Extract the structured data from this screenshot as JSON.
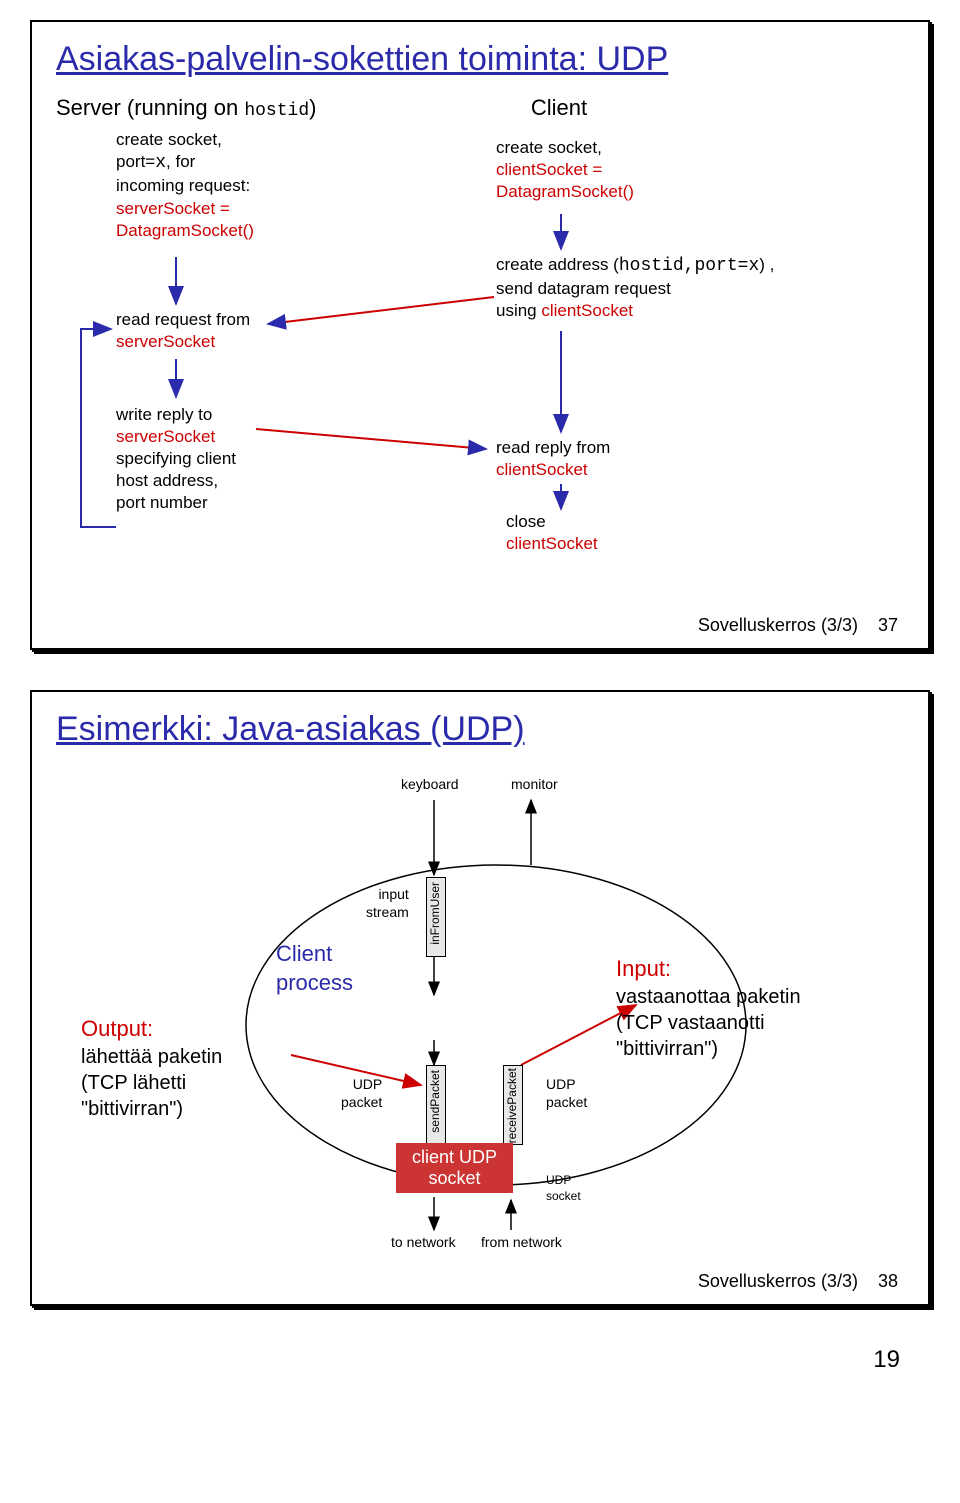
{
  "slide1": {
    "title": "Asiakas-palvelin-sokettien toiminta: UDP",
    "server_heading": "Server (running on ",
    "server_hostid": "hostid",
    "server_heading_close": ")",
    "client_heading": "Client",
    "s1_l1": "create socket,",
    "s1_l2a": "port=",
    "s1_l2b": "x",
    "s1_l2c": ", for",
    "s1_l3": "incoming request:",
    "s1_l4a": "serverSocket =",
    "s1_l4b": "DatagramSocket()",
    "s2_l1": "read request from",
    "s2_l2": "serverSocket",
    "s3_l1": "write reply to",
    "s3_l2": "serverSocket",
    "s3_l3": "specifying client",
    "s3_l4": "host address,",
    "s3_l5": "port number",
    "c1_l1": "create socket,",
    "c1_l2a": "clientSocket =",
    "c1_l2b": "DatagramSocket()",
    "c2_l1a": "create address (",
    "c2_l1b": "hostid,port=x",
    "c2_l1c": ") ,",
    "c2_l2": "send datagram request",
    "c2_l3a": "using ",
    "c2_l3b": "clientSocket",
    "c3_l1": "read reply from",
    "c3_l2": "clientSocket",
    "c4_l1": "close",
    "c4_l2": "clientSocket",
    "footer_label": "Sovelluskerros (3/3)",
    "footer_num": "37"
  },
  "slide2": {
    "title": "Esimerkki: Java-asiakas (UDP)",
    "keyboard": "keyboard",
    "monitor": "monitor",
    "input_stream": "input\nstream",
    "infromuser": "inFromUser",
    "client_process": "Client\nprocess",
    "output_h": "Output:",
    "output_b": "lähettää paketin\n(TCP lähetti\n\"bittivirran\")",
    "input_h": "Input:",
    "input_b": "vastaanottaa paketin\n(TCP vastaanotti\n\"bittivirran\")",
    "udp_packet": "UDP\npacket",
    "sendpacket": "sendPacket",
    "receivepacket": "receivePacket",
    "socket_label": "client UDP\nsocket",
    "udp_socket": "UDP\nsocket",
    "to_network": "to network",
    "from_network": "from network",
    "footer_label": "Sovelluskerros (3/3)",
    "footer_num": "38"
  },
  "page_number": "19"
}
